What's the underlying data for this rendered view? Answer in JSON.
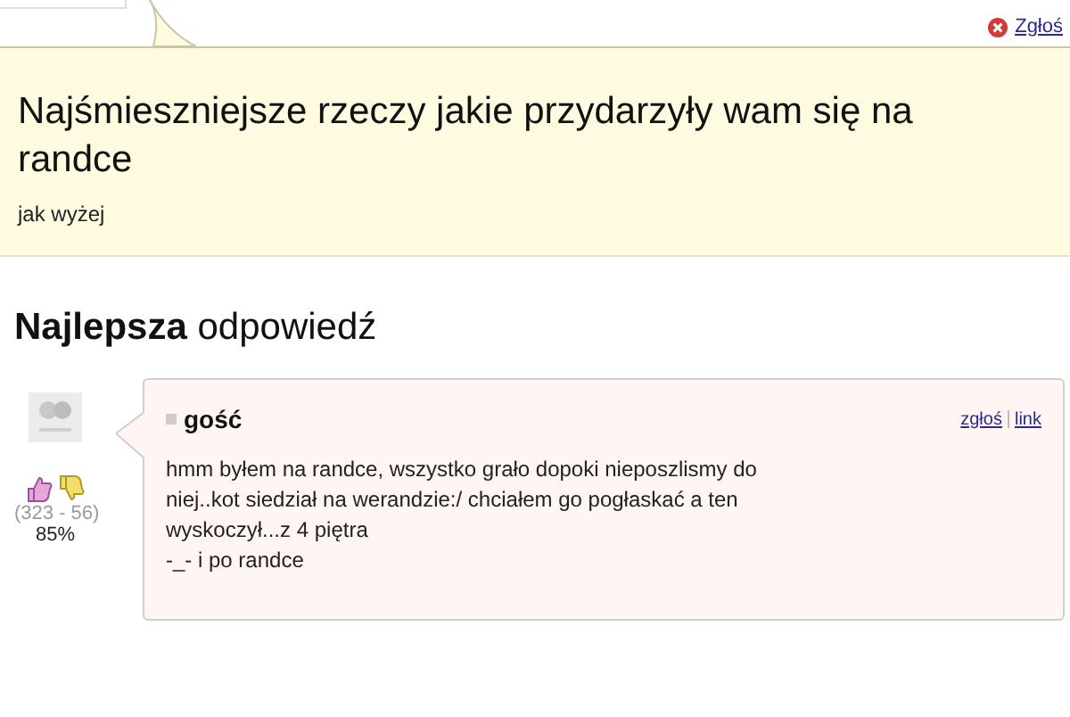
{
  "question": {
    "report_link": "Zgłoś",
    "title": "Najśmieszniejsze rzeczy jakie przydarzyły wam się na randce",
    "description": "jak wyżej"
  },
  "best_answer": {
    "heading": "**Najlepsza** odpowiedź",
    "votes": "(323 - 56)",
    "percent": "85%",
    "author": "gość",
    "links": [
      "zgłoś",
      "link"
    ],
    "text_lines": [
      "hmm byłem na randce, wszystko grało dopoki nieposzlismy do",
      "niej..kot siedział na werandzie:/ chciałem go pogłaskać a ten",
      "wyskoczył...z 4 piętra",
      "-_- i po randce"
    ]
  }
}
